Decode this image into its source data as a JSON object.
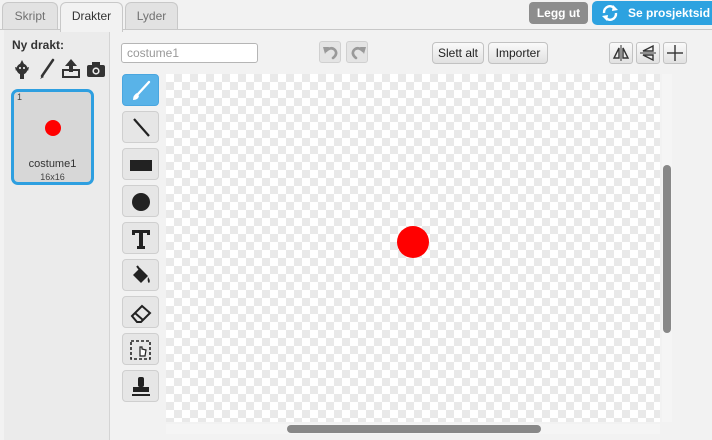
{
  "tabs": [
    {
      "label": "Skript"
    },
    {
      "label": "Drakter"
    },
    {
      "label": "Lyder"
    }
  ],
  "header": {
    "logout_label": "Legg ut",
    "project_label": "Se prosjektsid"
  },
  "sidebar": {
    "new_costume_label": "Ny drakt:",
    "new_icons": [
      "sprite-library-icon",
      "paint-brush-icon",
      "upload-icon",
      "camera-icon"
    ],
    "costume": {
      "index": "1",
      "name": "costume1",
      "size": "16x16",
      "color": "#ff0000"
    }
  },
  "editor": {
    "name_value": "costume1",
    "clear_label": "Slett alt",
    "import_label": "Importer",
    "tools": [
      "brush-tool",
      "line-tool",
      "rectangle-tool",
      "ellipse-tool",
      "text-tool",
      "fill-tool",
      "eraser-tool",
      "select-tool",
      "stamp-tool"
    ],
    "active_tool": "brush-tool",
    "accent": "#59b3e8",
    "selected_border": "#2e9fe0",
    "shape_color": "#ff0000"
  }
}
